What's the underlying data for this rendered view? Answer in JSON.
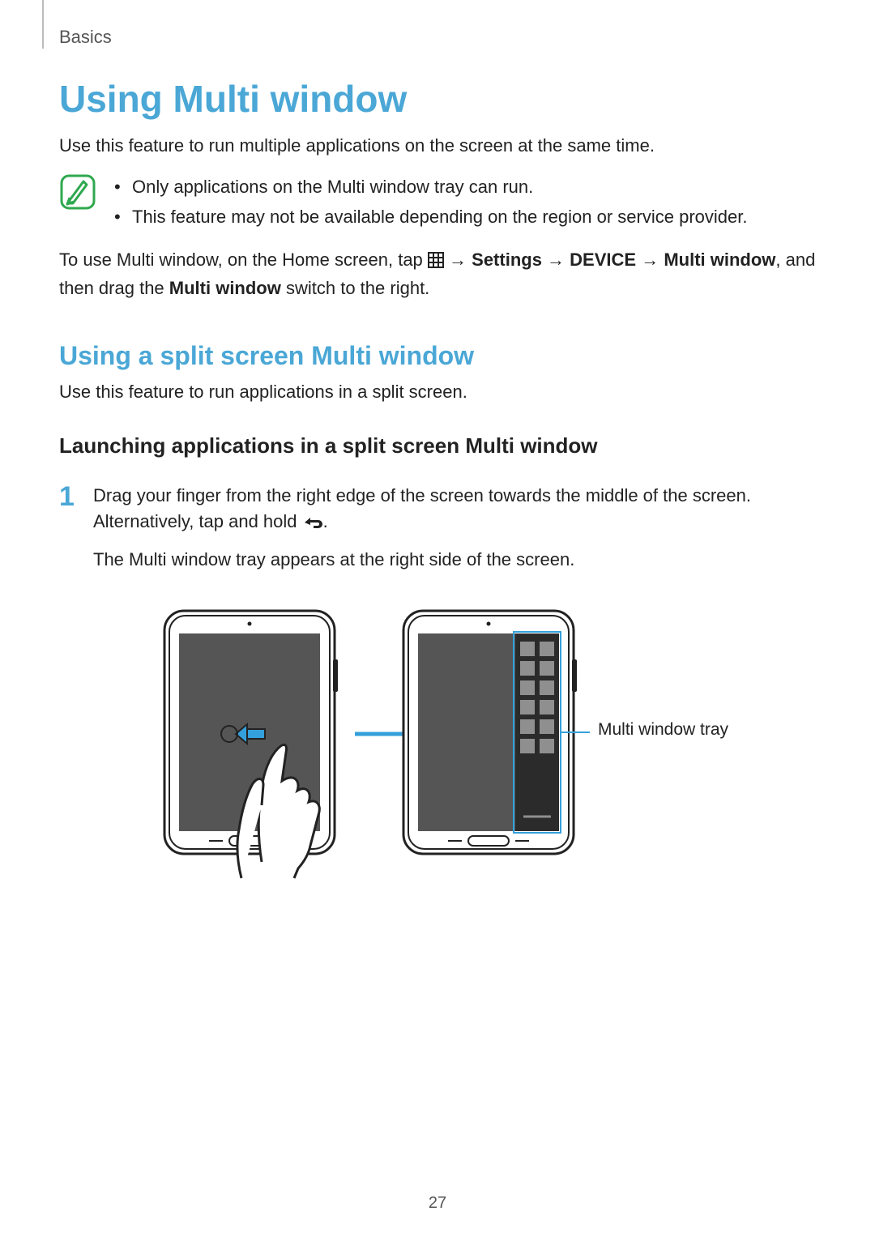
{
  "breadcrumb": "Basics",
  "h1": "Using Multi window",
  "intro": "Use this feature to run multiple applications on the screen at the same time.",
  "note": {
    "items": [
      "Only applications on the Multi window tray can run.",
      "This feature may not be available depending on the region or service provider."
    ]
  },
  "instruction": {
    "pre": "To use Multi window, on the Home screen, tap ",
    "arrow": " → ",
    "settings": "Settings",
    "device": "DEVICE",
    "multi": "Multi window",
    "mid": ", and then drag the ",
    "multi2": "Multi window",
    "post": " switch to the right."
  },
  "h2": "Using a split screen Multi window",
  "h2_sub": "Use this feature to run applications in a split screen.",
  "h3": "Launching applications in a split screen Multi window",
  "step1": {
    "num": "1",
    "line1a": "Drag your finger from the right edge of the screen towards the middle of the screen. Alternatively, tap and hold ",
    "line1b": ".",
    "line2": "The Multi window tray appears at the right side of the screen."
  },
  "callout": "Multi window tray",
  "page_number": "27"
}
